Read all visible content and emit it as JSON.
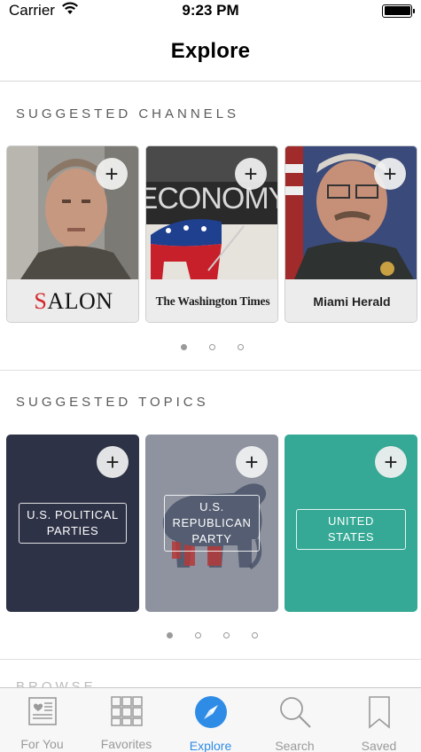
{
  "status_bar": {
    "carrier": "Carrier",
    "time": "9:23 PM",
    "battery_level": 1.0
  },
  "nav": {
    "title": "Explore"
  },
  "suggested_channels": {
    "heading": "SUGGESTED CHANNELS",
    "items": [
      {
        "name": "SALON",
        "logo_first": "S",
        "logo_rest": "ALON",
        "add_label": "+"
      },
      {
        "name": "The Washington Times",
        "add_label": "+",
        "photo_text": "ECONOMY"
      },
      {
        "name": "Miami Herald",
        "add_label": "+"
      }
    ],
    "page_count": 3,
    "active_page": 0
  },
  "suggested_topics": {
    "heading": "SUGGESTED TOPICS",
    "items": [
      {
        "label_line1": "U.S. POLITICAL",
        "label_line2": "PARTIES",
        "color": "#2d3246",
        "add_label": "+"
      },
      {
        "label_line1": "U.S.",
        "label_line2": "REPUBLICAN",
        "label_line3": "PARTY",
        "color": "#8e939f",
        "add_label": "+"
      },
      {
        "label_line1": "UNITED STATES",
        "color": "#35a995",
        "add_label": "+"
      }
    ],
    "page_count": 4,
    "active_page": 0
  },
  "next_section_peek": "BROWSE",
  "tab_bar": {
    "accent_color": "#2f8ce6",
    "tabs": [
      {
        "label": "For You",
        "icon": "newspaper-icon",
        "active": false
      },
      {
        "label": "Favorites",
        "icon": "grid-icon",
        "active": false
      },
      {
        "label": "Explore",
        "icon": "compass-icon",
        "active": true
      },
      {
        "label": "Search",
        "icon": "search-icon",
        "active": false
      },
      {
        "label": "Saved",
        "icon": "bookmark-icon",
        "active": false
      }
    ]
  }
}
